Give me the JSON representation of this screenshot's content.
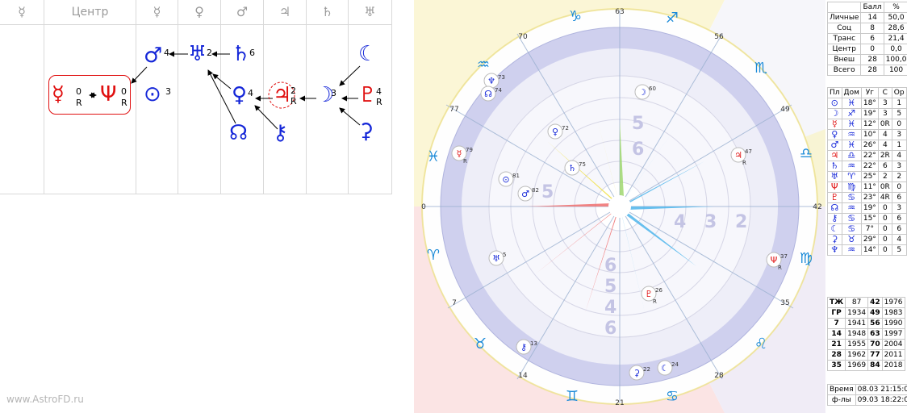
{
  "grid": {
    "headers": [
      "☿",
      "Центр",
      "☿",
      "♀",
      "♂",
      "♃",
      "♄",
      "♅"
    ],
    "nodes": [
      {
        "glyph": "☿",
        "deg": "0",
        "retro": "R",
        "color": "red"
      },
      {
        "glyph": "Ψ",
        "deg": "0",
        "retro": "R",
        "color": "red"
      },
      {
        "glyph": "⊙",
        "deg": "3",
        "retro": "",
        "color": "blue"
      },
      {
        "glyph": "♂",
        "deg": "4",
        "retro": "",
        "color": "blue"
      },
      {
        "glyph": "♅",
        "deg": "2",
        "retro": "",
        "color": "blue"
      },
      {
        "glyph": "♄",
        "deg": "6",
        "retro": "",
        "color": "blue"
      },
      {
        "glyph": "♀",
        "deg": "4",
        "retro": "",
        "color": "blue"
      },
      {
        "glyph": "♃",
        "deg": "2",
        "retro": "R",
        "color": "red"
      },
      {
        "glyph": "☽",
        "deg": "3",
        "retro": "",
        "color": "blue"
      },
      {
        "glyph": "♇",
        "deg": "4",
        "retro": "R",
        "color": "red"
      },
      {
        "glyph": "☾",
        "deg": "",
        "retro": "",
        "color": "blue"
      },
      {
        "glyph": "☊",
        "deg": "",
        "retro": "",
        "color": "blue"
      },
      {
        "glyph": "⚷",
        "deg": "",
        "retro": "",
        "color": "blue"
      },
      {
        "glyph": "⚳",
        "deg": "",
        "retro": "",
        "color": "blue"
      }
    ]
  },
  "watermark": "www.AstroFD.ru",
  "wheel": {
    "outer_degrees": [
      "63",
      "56",
      "49",
      "42",
      "35",
      "28",
      "21",
      "14",
      "7",
      "0",
      "77",
      "70"
    ],
    "signs": [
      "♑",
      "♐",
      "♏",
      "♎",
      "♍",
      "♌",
      "♋",
      "♊",
      "♉",
      "♈",
      "♓",
      "♒"
    ],
    "house_numbers": [
      "5",
      "6",
      "5",
      "4",
      "3",
      "2",
      "6",
      "5",
      "4",
      "6"
    ],
    "planets": [
      {
        "glyph": "☽",
        "deg": "60",
        "retro": "",
        "color": "#1426d8"
      },
      {
        "glyph": "♆",
        "deg": "73",
        "retro": "",
        "color": "#1426d8"
      },
      {
        "glyph": "☊",
        "deg": "74",
        "retro": "",
        "color": "#1426d8"
      },
      {
        "glyph": "♀",
        "deg": "72",
        "retro": "",
        "color": "#1426d8"
      },
      {
        "glyph": "♄",
        "deg": "75",
        "retro": "",
        "color": "#1426d8"
      },
      {
        "glyph": "☿",
        "deg": "79",
        "retro": "R",
        "color": "#e01010"
      },
      {
        "glyph": "⊙",
        "deg": "81",
        "retro": "",
        "color": "#1426d8"
      },
      {
        "glyph": "♂",
        "deg": "82",
        "retro": "",
        "color": "#1426d8"
      },
      {
        "glyph": "♃",
        "deg": "47",
        "retro": "R",
        "color": "#e01010"
      },
      {
        "glyph": "♅",
        "deg": "5",
        "retro": "",
        "color": "#1426d8"
      },
      {
        "glyph": "Ψ",
        "deg": "37",
        "retro": "R",
        "color": "#e01010"
      },
      {
        "glyph": "♇",
        "deg": "26",
        "retro": "R",
        "color": "#e01010"
      },
      {
        "glyph": "⚷",
        "deg": "13",
        "retro": "",
        "color": "#1426d8"
      },
      {
        "glyph": "⚳",
        "deg": "22",
        "retro": "",
        "color": "#1426d8"
      },
      {
        "glyph": "☾",
        "deg": "24",
        "retro": "",
        "color": "#1426d8"
      }
    ]
  },
  "summary": {
    "headers": [
      "",
      "Балл",
      "%"
    ],
    "rows": [
      [
        "Личные",
        "14",
        "50,0"
      ],
      [
        "Соц",
        "8",
        "28,6"
      ],
      [
        "Транс",
        "6",
        "21,4"
      ],
      [
        "Центр",
        "0",
        "0,0"
      ],
      [
        "Внеш",
        "28",
        "100,0"
      ],
      [
        "Всего",
        "28",
        "100"
      ]
    ]
  },
  "planets_table": {
    "headers": [
      "Пл",
      "Дом",
      "Уг",
      "С",
      "Ор"
    ],
    "rows": [
      [
        "⊙",
        "♓",
        "18°",
        "3",
        "1"
      ],
      [
        "☽",
        "♐",
        "19°",
        "3",
        "5"
      ],
      [
        "☿",
        "♓",
        "12°",
        "0R",
        "0"
      ],
      [
        "♀",
        "♒",
        "10°",
        "4",
        "3"
      ],
      [
        "♂",
        "♓",
        "26°",
        "4",
        "1"
      ],
      [
        "♃",
        "♎",
        "22°",
        "2R",
        "4"
      ],
      [
        "♄",
        "♒",
        "22°",
        "6",
        "3"
      ],
      [
        "♅",
        "♈",
        "25°",
        "2",
        "2"
      ],
      [
        "Ψ",
        "♍",
        "11°",
        "0R",
        "0"
      ],
      [
        "♇",
        "♋",
        "23°",
        "4R",
        "6"
      ],
      [
        "☊",
        "♒",
        "19°",
        "0",
        "3"
      ],
      [
        "⚷",
        "♋",
        "15°",
        "0",
        "6"
      ],
      [
        "☾",
        "♋",
        "7°",
        "0",
        "6"
      ],
      [
        "⚳",
        "♉",
        "29°",
        "0",
        "4"
      ],
      [
        "♆",
        "♒",
        "14°",
        "0",
        "5"
      ]
    ]
  },
  "years_table": {
    "headers": [
      "ТЖ",
      "87",
      "42",
      "1976"
    ],
    "rows": [
      [
        "ГР",
        "1934",
        "49",
        "1983"
      ],
      [
        "7",
        "1941",
        "56",
        "1990"
      ],
      [
        "14",
        "1948",
        "63",
        "1997"
      ],
      [
        "21",
        "1955",
        "70",
        "2004"
      ],
      [
        "28",
        "1962",
        "77",
        "2011"
      ],
      [
        "35",
        "1969",
        "84",
        "2018"
      ]
    ]
  },
  "time_table": {
    "rows": [
      [
        "Время",
        "08.03 21:15:00"
      ],
      [
        "ф-лы",
        "09.03 18:22:00"
      ]
    ]
  }
}
